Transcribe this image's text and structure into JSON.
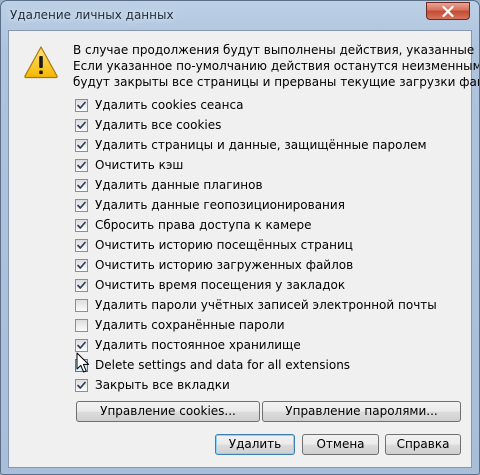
{
  "window": {
    "title": "Удаление личных данных"
  },
  "info": {
    "lines": [
      "В случае продолжения будут выполнены действия, указанные ниже.",
      "Если указанное по-умолчанию действия останутся неизменными,",
      "будут закрыты все страницы и прерваны текущие загрузки файлов."
    ]
  },
  "options": [
    {
      "label": "Удалить cookies сеанса",
      "checked": true
    },
    {
      "label": "Удалить все cookies",
      "checked": true
    },
    {
      "label": "Удалить страницы и данные, защищённые паролем",
      "checked": true
    },
    {
      "label": "Очистить кэш",
      "checked": true
    },
    {
      "label": "Удалить данные плагинов",
      "checked": true
    },
    {
      "label": "Удалить данные геопозиционирования",
      "checked": true
    },
    {
      "label": "Сбросить права доступа к камере",
      "checked": true
    },
    {
      "label": "Очистить историю посещённых страниц",
      "checked": true
    },
    {
      "label": "Очистить историю загруженных файлов",
      "checked": true
    },
    {
      "label": "Очистить время посещения у закладок",
      "checked": true
    },
    {
      "label": "Удалить пароли учётных записей электронной почты",
      "checked": false
    },
    {
      "label": "Удалить сохранённые пароли",
      "checked": false
    },
    {
      "label": "Удалить постоянное хранилище",
      "checked": true
    },
    {
      "label": "Delete settings and data for all extensions",
      "checked": false,
      "hovered": true
    },
    {
      "label": "Закрыть все вкладки",
      "checked": true
    }
  ],
  "buttons": {
    "manage_cookies": "Управление cookies...",
    "manage_passwords": "Управление паролями...",
    "delete": "Удалить",
    "cancel": "Отмена",
    "help": "Справка"
  },
  "icons": {
    "warning": "warning-triangle-icon",
    "close": "close-icon",
    "cursor": "mouse-pointer-icon"
  }
}
